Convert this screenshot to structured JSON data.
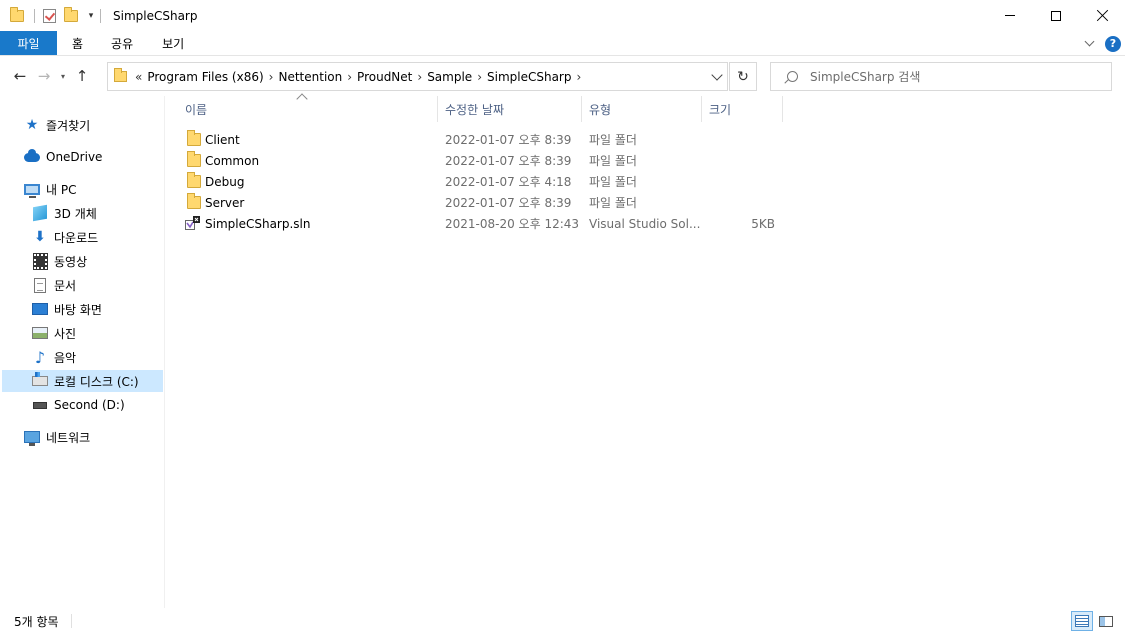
{
  "window": {
    "title": "SimpleCSharp"
  },
  "ribbon": {
    "tabs": [
      "파일",
      "홈",
      "공유",
      "보기"
    ]
  },
  "address": {
    "overflow": "«",
    "crumbs": [
      "Program Files (x86)",
      "Nettention",
      "ProudNet",
      "Sample",
      "SimpleCSharp"
    ]
  },
  "search": {
    "placeholder": "SimpleCSharp 검색"
  },
  "sidebar": {
    "items": [
      {
        "label": "즐겨찾기",
        "icon": "star-icon"
      },
      {
        "label": "OneDrive",
        "icon": "cloud-icon"
      },
      {
        "label": "내 PC",
        "icon": "computer-icon"
      },
      {
        "label": "3D 개체",
        "icon": "cube-icon"
      },
      {
        "label": "다운로드",
        "icon": "download-icon"
      },
      {
        "label": "동영상",
        "icon": "film-icon"
      },
      {
        "label": "문서",
        "icon": "document-icon"
      },
      {
        "label": "바탕 화면",
        "icon": "desktop-icon"
      },
      {
        "label": "사진",
        "icon": "picture-icon"
      },
      {
        "label": "음악",
        "icon": "music-icon"
      },
      {
        "label": "로컬 디스크 (C:)",
        "icon": "local-disk-icon",
        "selected": true
      },
      {
        "label": "Second (D:)",
        "icon": "drive-icon"
      },
      {
        "label": "네트워크",
        "icon": "network-icon"
      }
    ]
  },
  "columns": {
    "name": "이름",
    "date": "수정한 날짜",
    "type": "유형",
    "size": "크기"
  },
  "files": [
    {
      "name": "Client",
      "date": "2022-01-07 오후 8:39",
      "type": "파일 폴더",
      "size": "",
      "icon": "folder-icon"
    },
    {
      "name": "Common",
      "date": "2022-01-07 오후 8:39",
      "type": "파일 폴더",
      "size": "",
      "icon": "folder-icon"
    },
    {
      "name": "Debug",
      "date": "2022-01-07 오후 4:18",
      "type": "파일 폴더",
      "size": "",
      "icon": "folder-icon"
    },
    {
      "name": "Server",
      "date": "2022-01-07 오후 8:39",
      "type": "파일 폴더",
      "size": "",
      "icon": "folder-icon"
    },
    {
      "name": "SimpleCSharp.sln",
      "date": "2021-08-20 오후 12:43",
      "type": "Visual Studio Sol...",
      "size": "5KB",
      "icon": "visual-studio-solution-icon"
    }
  ],
  "status": {
    "count": "5개 항목"
  },
  "colors": {
    "accent": "#1979ca",
    "selection": "#cce8ff",
    "header_text": "#4d6185",
    "folder": "#ffd86f"
  }
}
